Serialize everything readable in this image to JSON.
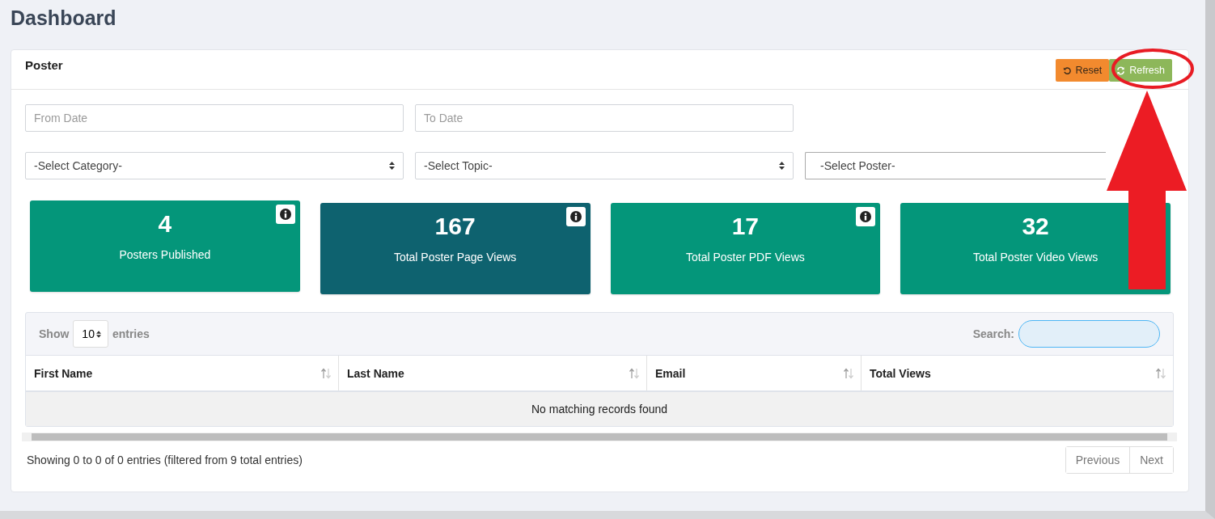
{
  "page_title": "Dashboard",
  "panel": {
    "title": "Poster",
    "buttons": [
      {
        "kind": "reset",
        "label": "Reset"
      },
      {
        "kind": "refresh",
        "label": "Refresh"
      }
    ]
  },
  "date_fields": [
    {
      "placeholder": "From Date"
    },
    {
      "placeholder": "To Date"
    }
  ],
  "selects": [
    {
      "value": "-Select Category-"
    },
    {
      "value": "-Select Topic-"
    },
    {
      "value": "-Select Poster-"
    }
  ],
  "stats": [
    {
      "value": "4",
      "label": "Posters Published",
      "color": "#04967a"
    },
    {
      "value": "167",
      "label": "Total Poster Page Views",
      "color": "#0e626f"
    },
    {
      "value": "17",
      "label": "Total Poster PDF Views",
      "color": "#04967a"
    },
    {
      "value": "32",
      "label": "Total Poster Video Views",
      "color": "#04967a"
    }
  ],
  "table": {
    "show_label": "Show",
    "page_length": "10",
    "entries_label": "entries",
    "search_label": "Search:",
    "columns": [
      "First Name",
      "Last Name",
      "Email",
      "Total Views"
    ],
    "empty_message": "No matching records found",
    "info": "Showing 0 to 0 of 0 entries (filtered from 9 total entries)",
    "pagination": [
      "Previous",
      "Next"
    ]
  }
}
